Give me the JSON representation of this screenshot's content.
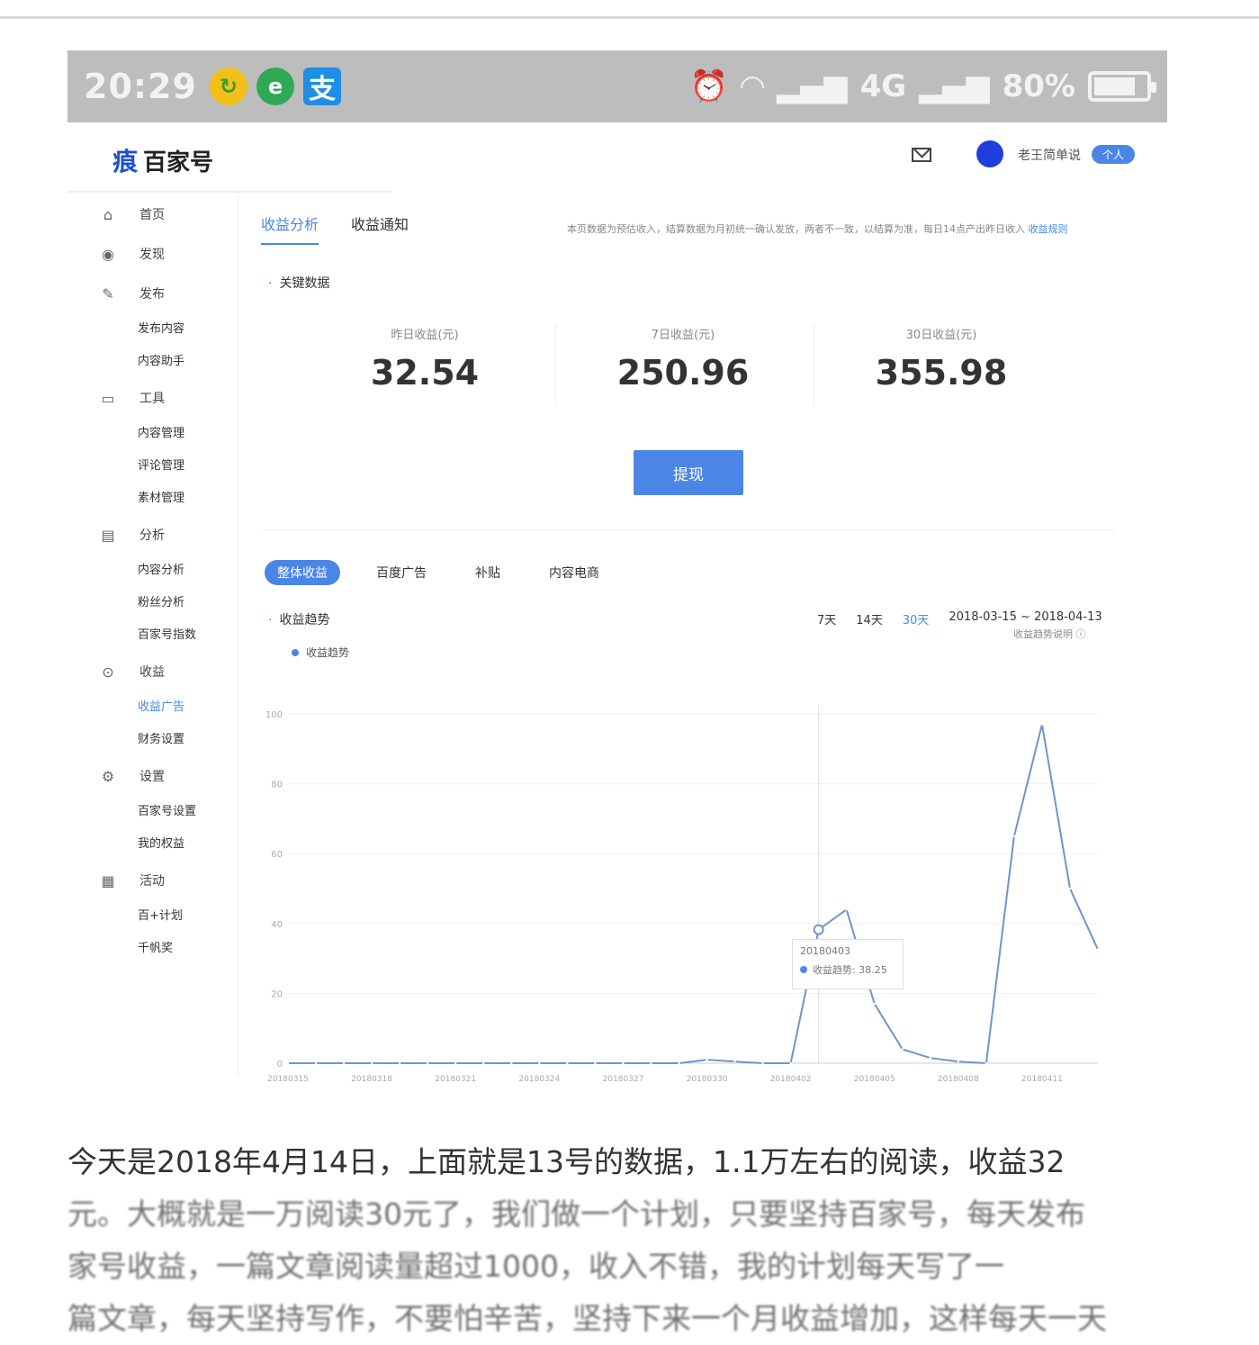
{
  "status_bar": {
    "time": "20:29",
    "apps": [
      {
        "icon": "refresh-app-icon",
        "glyph": "↻"
      },
      {
        "icon": "e-app-icon",
        "glyph": "e"
      },
      {
        "icon": "alipay-app-icon",
        "glyph": "支"
      }
    ],
    "network": "4G",
    "battery": "80%",
    "battery_level": 0.8
  },
  "header": {
    "logo_text": "百家号",
    "username": "老王简单说",
    "badge": "个人"
  },
  "sidebar": {
    "groups": [
      {
        "icon": "home-icon",
        "glyph": "⌂",
        "label": "首页",
        "items": []
      },
      {
        "icon": "eye-icon",
        "glyph": "◉",
        "label": "发现",
        "items": []
      },
      {
        "icon": "edit-icon",
        "glyph": "✎",
        "label": "发布",
        "items": [
          "发布内容",
          "内容助手"
        ]
      },
      {
        "icon": "tool-icon",
        "glyph": "▭",
        "label": "工具",
        "items": [
          "内容管理",
          "评论管理",
          "素材管理"
        ]
      },
      {
        "icon": "chart-icon",
        "glyph": "▤",
        "label": "分析",
        "items": [
          "内容分析",
          "粉丝分析",
          "百家号指数"
        ]
      },
      {
        "icon": "income-icon",
        "glyph": "⊙",
        "label": "收益",
        "items": [
          "收益广告",
          "财务设置"
        ]
      },
      {
        "icon": "settings-icon",
        "glyph": "⚙",
        "label": "设置",
        "items": [
          "百家号设置",
          "我的权益"
        ]
      },
      {
        "icon": "activity-icon",
        "glyph": "▦",
        "label": "活动",
        "items": [
          "百+计划",
          "千帆奖"
        ]
      }
    ]
  },
  "main": {
    "tabs": [
      "收益分析",
      "收益通知"
    ],
    "notice": "本页数据为预估收入，结算数据为月初统一确认发放，两者不一致，以结算为准，每日14点产出昨日收入",
    "notice_link": "收益规则",
    "key_data_title": "关键数据",
    "stats": [
      {
        "label": "昨日收益(元)",
        "value": "32.54"
      },
      {
        "label": "7日收益(元)",
        "value": "250.96"
      },
      {
        "label": "30日收益(元)",
        "value": "355.98"
      }
    ],
    "withdraw_label": "提现",
    "subtabs": [
      "整体收益",
      "百度广告",
      "补贴",
      "内容电商"
    ],
    "trend_title": "收益趋势",
    "range_options": [
      "7天",
      "14天",
      "30天"
    ],
    "range_active": "30天",
    "date_range": "2018-03-15 ~ 2018-04-13",
    "range_note": "收益趋势说明",
    "legend_label": "收益趋势",
    "tooltip_date": "20180403",
    "tooltip_text": "收益趋势: 38.25"
  },
  "chart_data": {
    "type": "line",
    "ylim": [
      0,
      100
    ],
    "y_ticks": [
      "0",
      "20",
      "40",
      "60",
      "80",
      "100"
    ],
    "x_ticks": [
      "20180315",
      "20180318",
      "20180321",
      "20180324",
      "20180327",
      "20180330",
      "20180402",
      "20180405",
      "20180408",
      "20180411"
    ],
    "series": [
      {
        "values": [
          0,
          0,
          0,
          0,
          0,
          0,
          0,
          0,
          0,
          0,
          0,
          0,
          0,
          0,
          0,
          1,
          0.5,
          0,
          0,
          38.25,
          44,
          17,
          4,
          1.5,
          0.5,
          0,
          65,
          97,
          50,
          32.54
        ]
      }
    ],
    "highlight_index": 19
  },
  "article": {
    "line1": "今天是2018年4月14日，上面就是13号的数据，1.1万左右的阅读，收益32",
    "line2": "元。大概就是一万阅读30元了，我们做一个计划，只要坚持百家号，每天发布",
    "line3": "家号收益，一篇文章阅读量超过1000，收入不错，我的计划每天写了一",
    "line4": "篇文章，每天坚持写作，不要怕辛苦，坚持下来一个月收益增加，这样每天一天"
  }
}
